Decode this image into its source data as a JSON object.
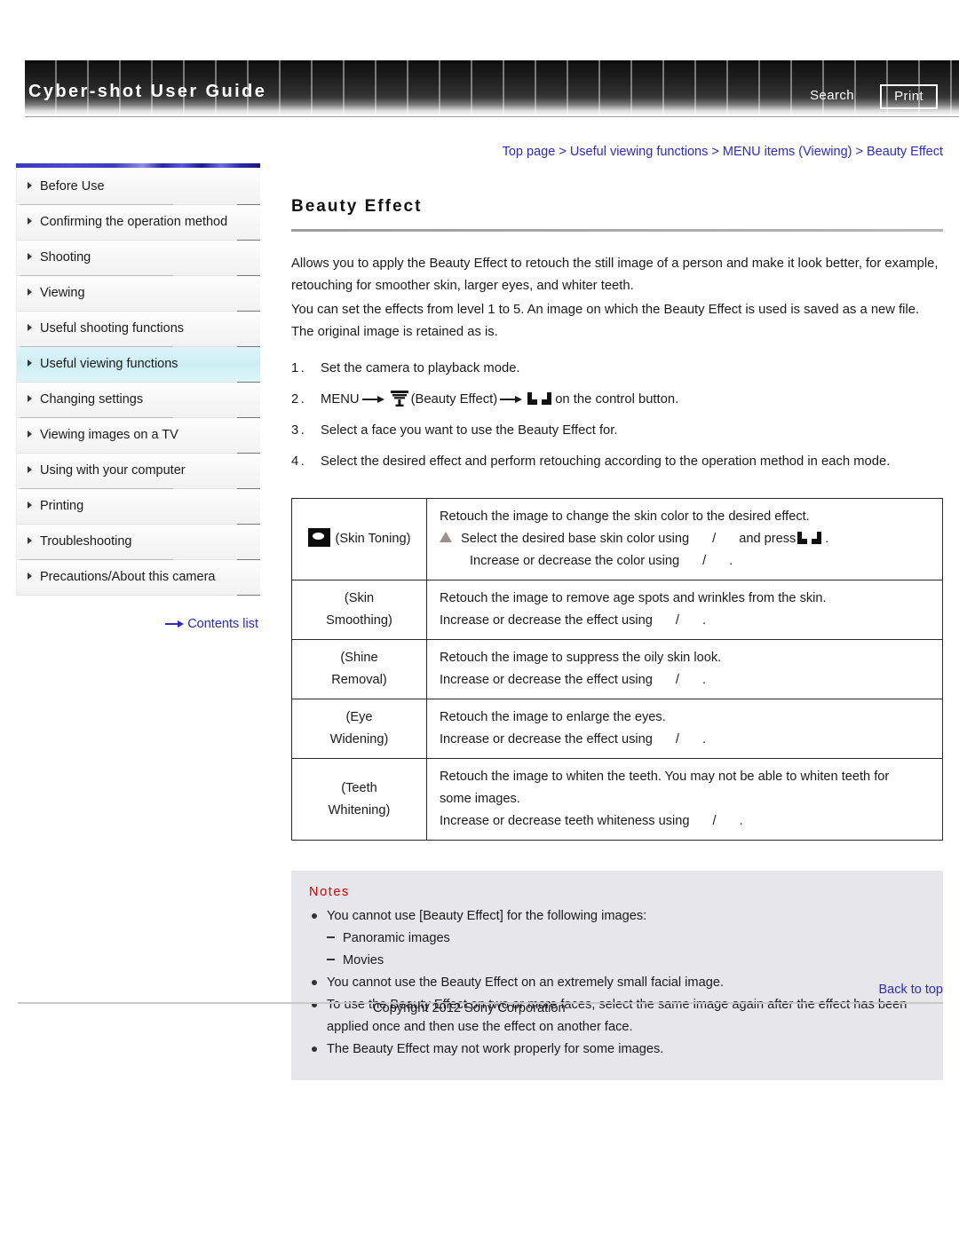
{
  "header": {
    "site_title": "Cyber-shot User Guide",
    "search_label": "Search",
    "print_label": "Print"
  },
  "breadcrumb": {
    "items": [
      "Top page",
      "Useful viewing functions",
      "MENU items (Viewing)",
      "Beauty Effect"
    ],
    "separator": ">"
  },
  "sidebar": {
    "items": [
      {
        "label": "Before Use",
        "active": false
      },
      {
        "label": "Confirming the operation method",
        "active": false
      },
      {
        "label": "Shooting",
        "active": false
      },
      {
        "label": "Viewing",
        "active": false
      },
      {
        "label": "Useful shooting functions",
        "active": false
      },
      {
        "label": "Useful viewing functions",
        "active": true
      },
      {
        "label": "Changing settings",
        "active": false
      },
      {
        "label": "Viewing images on a TV",
        "active": false
      },
      {
        "label": "Using with your computer",
        "active": false
      },
      {
        "label": "Printing",
        "active": false
      },
      {
        "label": "Troubleshooting",
        "active": false
      },
      {
        "label": "Precautions/About this camera",
        "active": false
      }
    ],
    "contents_list_label": "Contents list"
  },
  "main": {
    "title": "Beauty Effect",
    "paragraphs": [
      "Allows you to apply the Beauty Effect to retouch the still image of a person and make it look better, for example, retouching for smoother skin, larger eyes, and whiter teeth.",
      "You can set the effects from level 1 to 5. An image on which the Beauty Effect is used is saved as a new file. The original image is retained as is."
    ],
    "steps": [
      {
        "num": "1.",
        "text": "Set the camera to playback mode."
      },
      {
        "num": "2.",
        "prefix": "MENU",
        "icon_label": "(Beauty Effect)",
        "suffix": "on the control button."
      },
      {
        "num": "3.",
        "text": "Select a face you want to use the Beauty Effect for."
      },
      {
        "num": "4.",
        "text": "Select the desired effect and perform retouching according to the operation method in each mode."
      }
    ]
  },
  "effects_table": {
    "rows": [
      {
        "mode_icon": "skin-toning-icon",
        "mode_label": "(Skin Toning)",
        "mode_label_line2": "",
        "lines": [
          {
            "text": "Retouch the image to change the skin color to the desired effect.",
            "marker": "none",
            "indent": false
          },
          {
            "text": "Select the desired base skin color using",
            "marker": "triangle",
            "indent": false,
            "tail": "/",
            "tail2": "and press",
            "has_ctrl_icon": true,
            "period": "."
          },
          {
            "text": "Increase or decrease the color using",
            "marker": "none",
            "indent": true,
            "tail": "/",
            "period": "."
          }
        ]
      },
      {
        "mode_icon": "none",
        "mode_label": "(Skin",
        "mode_label_line2": "Smoothing)",
        "lines": [
          {
            "text": "Retouch the image to remove age spots and wrinkles from the skin.",
            "marker": "none",
            "indent": false
          },
          {
            "text": "Increase or decrease the effect using",
            "marker": "none",
            "indent": false,
            "tail": "/",
            "period": "."
          }
        ]
      },
      {
        "mode_icon": "none",
        "mode_label": "(Shine",
        "mode_label_line2": "Removal)",
        "lines": [
          {
            "text": "Retouch the image to suppress the oily skin look.",
            "marker": "none",
            "indent": false
          },
          {
            "text": "Increase or decrease the effect using",
            "marker": "none",
            "indent": false,
            "tail": "/",
            "period": "."
          }
        ]
      },
      {
        "mode_icon": "none",
        "mode_label": "(Eye",
        "mode_label_line2": "Widening)",
        "lines": [
          {
            "text": "Retouch the image to enlarge the eyes.",
            "marker": "none",
            "indent": false
          },
          {
            "text": "Increase or decrease the effect using",
            "marker": "none",
            "indent": false,
            "tail": "/",
            "period": "."
          }
        ]
      },
      {
        "mode_icon": "none",
        "mode_label": "(Teeth",
        "mode_label_line2": "Whitening)",
        "lines": [
          {
            "text": "Retouch the image to whiten the teeth. You may not be able to whiten teeth for",
            "marker": "none",
            "indent": false
          },
          {
            "text": "some images.",
            "marker": "none",
            "indent": false
          },
          {
            "text": "Increase or decrease teeth whiteness using",
            "marker": "none",
            "indent": false,
            "tail": "/",
            "period": "."
          }
        ]
      }
    ]
  },
  "notes": {
    "title": "Notes",
    "items": [
      {
        "type": "bullet",
        "text": "You cannot use [Beauty Effect] for the following images:"
      },
      {
        "type": "dash",
        "text": "Panoramic images"
      },
      {
        "type": "dash",
        "text": "Movies"
      },
      {
        "type": "bullet",
        "text": "You cannot use the Beauty Effect on an extremely small facial image."
      },
      {
        "type": "bullet",
        "text": "To use the Beauty Effect on two or more faces, select the same image again after the effect has been applied once and then use the effect on another face."
      },
      {
        "type": "bullet",
        "text": "The Beauty Effect may not work properly for some images."
      }
    ]
  },
  "footer": {
    "back_to_top": "Back to top",
    "copyright": "Copyright 2012 Sony Corporation"
  },
  "colors": {
    "link": "#2b2bbd",
    "notes_title": "#d00000",
    "notes_bg": "#e7e7eb",
    "active_nav": "#cdeef4"
  }
}
